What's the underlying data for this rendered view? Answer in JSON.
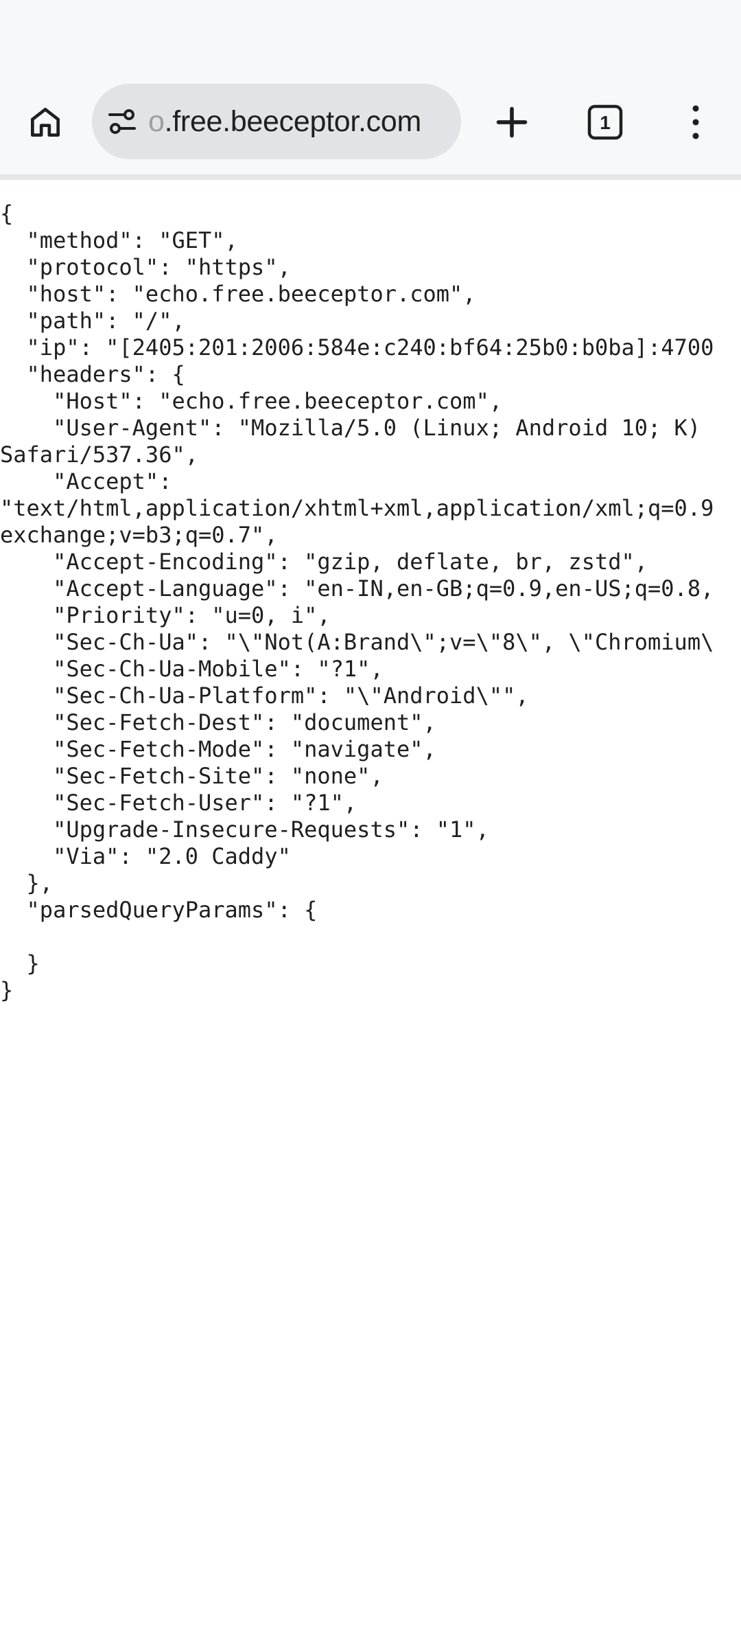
{
  "browser": {
    "url_hidden_prefix": "o",
    "url_visible": ".free.beeceptor.com",
    "tab_count": "1",
    "icons": {
      "home": "home-icon",
      "site_info": "tune-icon",
      "new_tab": "plus-icon",
      "tabs": "tab-switcher-icon",
      "menu": "more-vert-icon"
    }
  },
  "page": {
    "lines": [
      "{",
      "  \"method\": \"GET\",",
      "  \"protocol\": \"https\",",
      "  \"host\": \"echo.free.beeceptor.com\",",
      "  \"path\": \"/\",",
      "  \"ip\": \"[2405:201:2006:584e:c240:bf64:25b0:b0ba]:4700",
      "  \"headers\": {",
      "    \"Host\": \"echo.free.beeceptor.com\",",
      "    \"User-Agent\": \"Mozilla/5.0 (Linux; Android 10; K)",
      "Safari/537.36\",",
      "    \"Accept\":",
      "\"text/html,application/xhtml+xml,application/xml;q=0.9",
      "exchange;v=b3;q=0.7\",",
      "    \"Accept-Encoding\": \"gzip, deflate, br, zstd\",",
      "    \"Accept-Language\": \"en-IN,en-GB;q=0.9,en-US;q=0.8,",
      "    \"Priority\": \"u=0, i\",",
      "    \"Sec-Ch-Ua\": \"\\\"Not(A:Brand\\\";v=\\\"8\\\", \\\"Chromium\\",
      "    \"Sec-Ch-Ua-Mobile\": \"?1\",",
      "    \"Sec-Ch-Ua-Platform\": \"\\\"Android\\\"\",",
      "    \"Sec-Fetch-Dest\": \"document\",",
      "    \"Sec-Fetch-Mode\": \"navigate\",",
      "    \"Sec-Fetch-Site\": \"none\",",
      "    \"Sec-Fetch-User\": \"?1\",",
      "    \"Upgrade-Insecure-Requests\": \"1\",",
      "    \"Via\": \"2.0 Caddy\"",
      "  },",
      "  \"parsedQueryParams\": {",
      "",
      "  }",
      "}"
    ]
  }
}
